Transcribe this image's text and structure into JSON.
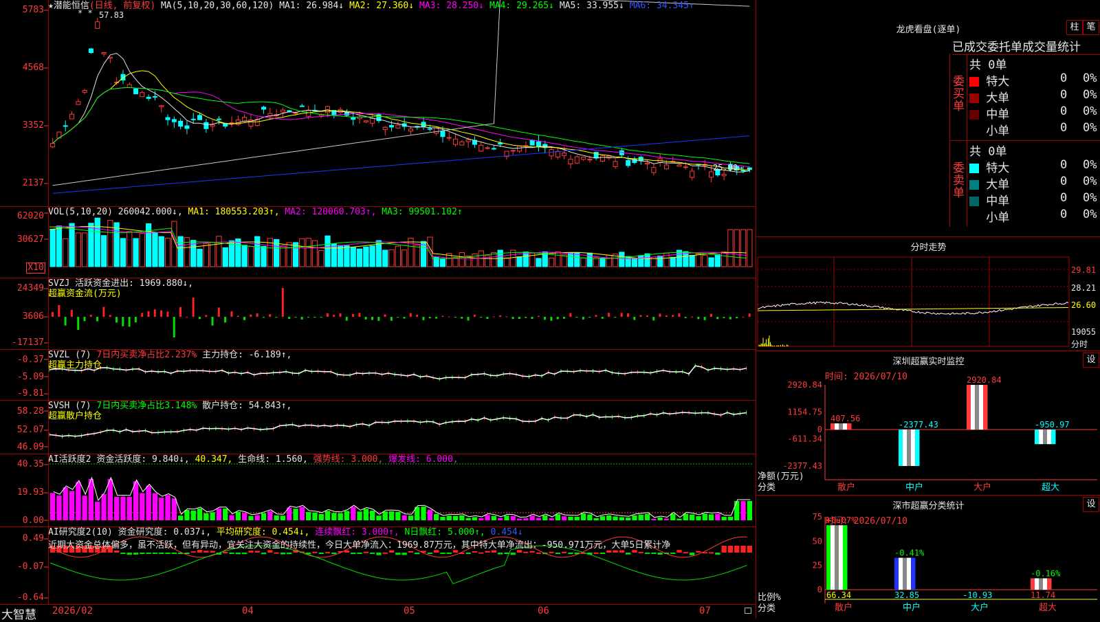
{
  "stock": {
    "star": "★",
    "name": "潜能恒信",
    "period": "(日线, 前复权)",
    "ma_label": "MA(5,10,20,30,60,120)"
  },
  "ma_values": [
    {
      "name": "MA1:",
      "value": "26.984↓",
      "color": "#e6e6e6"
    },
    {
      "name": "MA2:",
      "value": "27.360↓",
      "color": "#ffff00"
    },
    {
      "name": "MA3:",
      "value": "28.250↓",
      "color": "#ff00ff"
    },
    {
      "name": "MA4:",
      "value": "29.265↓",
      "color": "#00ff00"
    },
    {
      "name": "MA5:",
      "value": "33.955↓",
      "color": "#e6e6e6"
    },
    {
      "name": "MA6:",
      "value": "34.345↑",
      "color": "#3355ff"
    }
  ],
  "price_axis": [
    "5783",
    "4568",
    "3352",
    "2137"
  ],
  "price_annotations": {
    "high": "57.83",
    "low": "25.00→",
    "stars": "* *"
  },
  "vol": {
    "label": "VOL(5,10,20)",
    "value": "260042.000↓,",
    "ma1": "MA1: 180553.203↑,",
    "ma2": "MA2: 120060.703↑,",
    "ma3": "MA3: 99501.102↑",
    "axis": [
      "62020",
      "30627",
      "X10"
    ]
  },
  "svzj": {
    "label": "SVZJ",
    "text": "活跃资金进出: 1969.880↓,",
    "sub": "超赢资金流(万元)",
    "axis": [
      "24349",
      "3606",
      "-17137"
    ]
  },
  "svzl": {
    "label": "SVZL (7)",
    "text1": "7日内买卖净占比2.237%",
    "text2": "主力持仓: -6.189↑,",
    "sub": "超赢主力持仓",
    "axis": [
      "-0.37",
      "-5.09",
      "-9.81"
    ]
  },
  "svsh": {
    "label": "SVSH (7)",
    "text1": "7日内买卖净占比3.148%",
    "text2": "散户持仓: 54.843↑,",
    "sub": "超赢散户持仓",
    "axis": [
      "58.28",
      "52.07",
      "46.09"
    ]
  },
  "ai1": {
    "label": "AI活跃度2",
    "t1": "资金活跃度: 9.840↓,",
    "t2": "40.347,",
    "t3": "生命线: 1.560,",
    "t4": "强势线: 3.000,",
    "t5": "爆发线: 6.000,",
    "axis": [
      "40.35",
      "19.93",
      "0.00"
    ]
  },
  "ai2": {
    "label": "AI研究度2(10)",
    "t1": "资金研究度: 0.037↓,",
    "t2": "平均研究度: 0.454↓,",
    "t3": "连续飘红: 3.000↑,",
    "t4": "N日飘红: 5.000↑,",
    "t5": "0.454↓",
    "comment": "近期大资金总体偏多，虽不活跃，但有异动，宜关注大资金的持续性，今日大单净流入：1969.87万元，其中特大单净流出：-950.971万元，大单5日累计净",
    "axis": [
      "0.49",
      "-0.07",
      "-0.64"
    ]
  },
  "x_axis": {
    "brand": "大智慧",
    "labels": [
      "2026/02",
      "04",
      "05",
      "06",
      "07"
    ]
  },
  "right": {
    "lhkp": {
      "title": "龙虎看盘(逐单)",
      "btn1": "柱",
      "btn2": "笔",
      "subtitle": "已成交委托单成交量统计",
      "buy": {
        "side": "委买单",
        "total": "共 0单",
        "rows": [
          {
            "name": "特大",
            "n": "0",
            "p": "0%",
            "color": "#ff0000"
          },
          {
            "name": "大单",
            "n": "0",
            "p": "0%",
            "color": "#990000"
          },
          {
            "name": "中单",
            "n": "0",
            "p": "0%",
            "color": "#660000"
          },
          {
            "name": "小单",
            "n": "0",
            "p": "0%",
            "color": "#000000"
          }
        ]
      },
      "sell": {
        "side": "委卖单",
        "total": "共 0单",
        "rows": [
          {
            "name": "特大",
            "n": "0",
            "p": "0%",
            "color": "#00ffff"
          },
          {
            "name": "大单",
            "n": "0",
            "p": "0%",
            "color": "#008080"
          },
          {
            "name": "中单",
            "n": "0",
            "p": "0%",
            "color": "#006666"
          },
          {
            "name": "小单",
            "n": "0",
            "p": "0%",
            "color": "#000000"
          }
        ]
      }
    },
    "fs": {
      "title": "分时走势",
      "axis": [
        "29.81",
        "28.21",
        "26.60",
        "19055",
        "分时"
      ]
    },
    "sz": {
      "title": "深圳超赢实时监控",
      "btn": "设",
      "time": "时间: 2026/07/10",
      "axis": [
        "2920.84",
        "1154.75",
        "0",
        "-611.34",
        "-2377.43"
      ],
      "ylabel": "净额(万元)",
      "xlabel": "分类",
      "cats": [
        "散户",
        "中户",
        "大户",
        "超大"
      ],
      "values": [
        407.56,
        -2377.43,
        2920.84,
        -950.97
      ],
      "labels": [
        "407.56",
        "-2377.43",
        "2920.84",
        "-950.97"
      ]
    },
    "ss": {
      "title": "深市超赢分类统计",
      "btn": "设",
      "time": "时间: 2026/07/10",
      "axis": [
        "75",
        "50",
        "25",
        "0"
      ],
      "ylabel": "比例%",
      "xlabel": "分类",
      "cats": [
        "散户",
        "中户",
        "大户",
        "超大"
      ],
      "bars": [
        66.34,
        32.85,
        0,
        11.74
      ],
      "pct": [
        "+0.07%",
        "-0.41%",
        "",
        "-0.16%"
      ],
      "vals": [
        "66.34",
        "32.85",
        "-10.93",
        "11.74"
      ]
    }
  },
  "chart_data": [
    {
      "type": "candlestick",
      "title": "潜能恒信 (日线, 前复权)",
      "ylim": [
        21.37,
        57.83
      ]
    },
    {
      "type": "bar",
      "title": "深圳超赢实时监控",
      "categories": [
        "散户",
        "中户",
        "大户",
        "超大"
      ],
      "values": [
        407.56,
        -2377.43,
        2920.84,
        -950.97
      ],
      "ylabel": "净额(万元)",
      "xlabel": "分类",
      "ylim": [
        -2377.43,
        2920.84
      ]
    },
    {
      "type": "bar",
      "title": "深市超赢分类统计",
      "categories": [
        "散户",
        "中户",
        "大户",
        "超大"
      ],
      "values": [
        66.34,
        32.85,
        -10.93,
        11.74
      ],
      "ylabel": "比例%",
      "xlabel": "分类",
      "ylim": [
        0,
        75
      ]
    }
  ]
}
